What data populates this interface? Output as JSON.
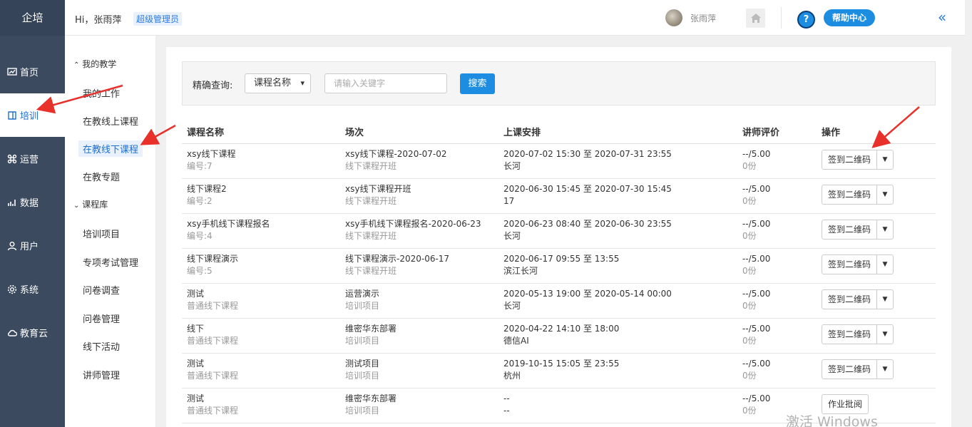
{
  "brand": "企培",
  "nav": [
    {
      "label": "首页",
      "icon": "chart-icon"
    },
    {
      "label": "培训",
      "icon": "book-icon",
      "active": true
    },
    {
      "label": "运营",
      "icon": "command-icon"
    },
    {
      "label": "数据",
      "icon": "bar-chart-icon"
    },
    {
      "label": "用户",
      "icon": "user-icon"
    },
    {
      "label": "系统",
      "icon": "gear-icon"
    },
    {
      "label": "教育云",
      "icon": "cloud-icon"
    }
  ],
  "header": {
    "greeting": "Hi，张雨萍",
    "role": "超级管理员",
    "username": "张雨萍",
    "help_label": "帮助中心",
    "help_glyph": "?",
    "collapse_glyph": "«"
  },
  "subnav": {
    "group1": "我的教学",
    "group1_items": [
      "我的工作",
      "在教线上课程",
      "在教线下课程",
      "在教专题"
    ],
    "group2": "课程库",
    "group2_items": [
      "培训项目",
      "专项考试管理",
      "问卷调查",
      "问卷管理",
      "线下活动",
      "讲师管理"
    ]
  },
  "search": {
    "label": "精确查询:",
    "select_value": "课程名称",
    "placeholder": "请输入关键字",
    "button": "搜索"
  },
  "table": {
    "headers": [
      "课程名称",
      "场次",
      "上课安排",
      "讲师评价",
      "操作"
    ],
    "rows": [
      {
        "name": "xsy线下课程",
        "code": "编号:7",
        "session": "xsy线下课程-2020-07-02",
        "session_type": "线下课程开班",
        "time": "2020-07-02 15:30 至 2020-07-31 23:55",
        "place": "长河",
        "score": "--/5.00",
        "count": "0份",
        "action": "签到二维码",
        "dropdown": true
      },
      {
        "name": "线下课程2",
        "code": "编号:2",
        "session": "xsy线下课程开班",
        "session_type": "线下课程开班",
        "time": "2020-06-30 15:45 至 2020-07-30 15:45",
        "place": "17",
        "score": "--/5.00",
        "count": "0份",
        "action": "签到二维码",
        "dropdown": true
      },
      {
        "name": "xsy手机线下课程报名",
        "code": "编号:4",
        "session": "xsy手机线下课程报名-2020-06-23",
        "session_type": "线下课程开班",
        "time": "2020-06-23 08:40 至 2020-06-30 23:55",
        "place": "长河",
        "score": "--/5.00",
        "count": "0份",
        "action": "签到二维码",
        "dropdown": true
      },
      {
        "name": "线下课程演示",
        "code": "编号:5",
        "session": "线下课程演示-2020-06-17",
        "session_type": "线下课程开班",
        "time": "2020-06-17 09:55 至 13:55",
        "place": "滨江长河",
        "score": "--/5.00",
        "count": "0份",
        "action": "签到二维码",
        "dropdown": true
      },
      {
        "name": "测试",
        "code": "普通线下课程",
        "session": "运营演示",
        "session_type": "培训项目",
        "time": "2020-05-13 19:00 至 2020-05-14 00:00",
        "place": "长河",
        "score": "--/5.00",
        "count": "0份",
        "action": "签到二维码",
        "dropdown": true
      },
      {
        "name": "线下",
        "code": "普通线下课程",
        "session": "维密华东部署",
        "session_type": "培训项目",
        "time": "2020-04-22 14:10 至 18:00",
        "place": "德信AI",
        "score": "--/5.00",
        "count": "0份",
        "action": "签到二维码",
        "dropdown": true
      },
      {
        "name": "测试",
        "code": "普通线下课程",
        "session": "测试项目",
        "session_type": "培训项目",
        "time": "2019-10-15 15:05 至 23:55",
        "place": "杭州",
        "score": "--/5.00",
        "count": "0份",
        "action": "签到二维码",
        "dropdown": true
      },
      {
        "name": "测试",
        "code": "普通线下课程",
        "session": "维密华东部署",
        "session_type": "培训项目",
        "time": "--",
        "place": "--",
        "score": "--/5.00",
        "count": "0份",
        "action": "作业批阅",
        "dropdown": false
      }
    ]
  },
  "watermark": "激活 Windows",
  "colors": {
    "sidebar": "#3b4a5e",
    "accent": "#1c8de0",
    "annotation_arrow": "#e8312b"
  }
}
